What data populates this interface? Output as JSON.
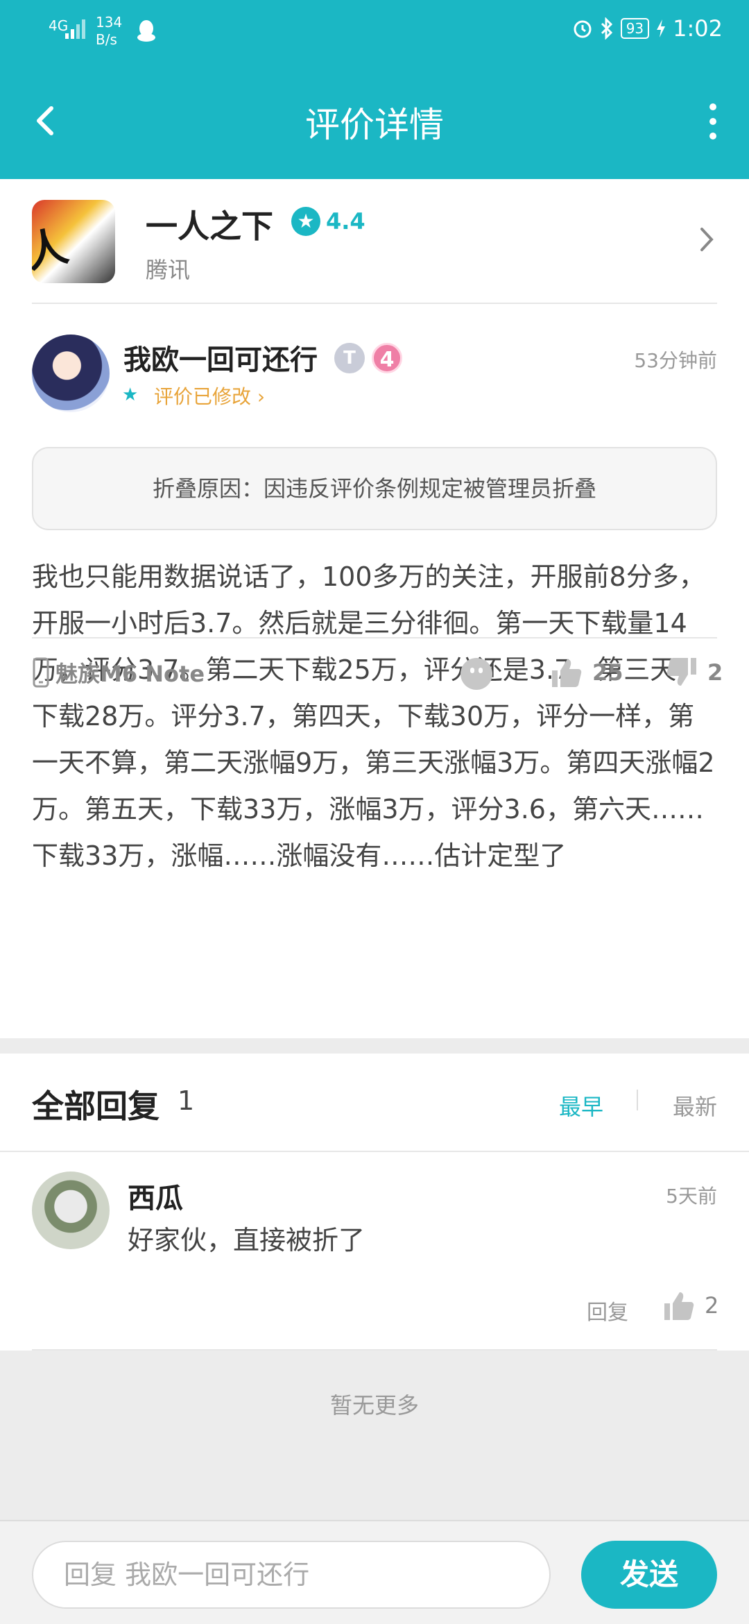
{
  "status_bar": {
    "network": "4G",
    "speed_value": "134",
    "speed_unit": "B/s",
    "battery": "93",
    "time": "1:02"
  },
  "header": {
    "title": "评价详情"
  },
  "app": {
    "name": "一人之下",
    "rating": "4.4",
    "publisher": "腾讯",
    "icon_glyph": "人之下"
  },
  "review": {
    "username": "我欧一回可还行",
    "badge_t": "T",
    "badge_level": "4",
    "time": "53分钟前",
    "modified_label": "评价已修改 ›",
    "fold_reason": "折叠原因：因违反评价条例规定被管理员折叠",
    "content": "我也只能用数据说话了，100多万的关注，开服前8分多，开服一小时后3.7。然后就是三分徘徊。第一天下载量14万，评分3.7。第二天下载25万，评分还是3.7。第三天，下载28万。评分3.7，第四天，下载30万，评分一样，第一天不算，第二天涨幅9万，第三天涨幅3万。第四天涨幅2万。第五天，下载33万，涨幅3万，评分3.6，第六天……下载33万，涨幅……涨幅没有……估计定型了",
    "device": "魅族M6 Note",
    "likes": "25",
    "dislikes": "2"
  },
  "replies": {
    "title": "全部回复",
    "count": "1",
    "sort_earliest": "最早",
    "sort_latest": "最新",
    "items": [
      {
        "username": "西瓜",
        "time": "5天前",
        "text": "好家伙，直接被折了",
        "reply_label": "回复",
        "likes": "2"
      }
    ],
    "no_more": "暂无更多"
  },
  "bottom": {
    "placeholder": "回复 我欧一回可还行",
    "send_label": "发送"
  },
  "colors": {
    "accent": "#1bb7c4",
    "modified": "#e8a43a"
  }
}
